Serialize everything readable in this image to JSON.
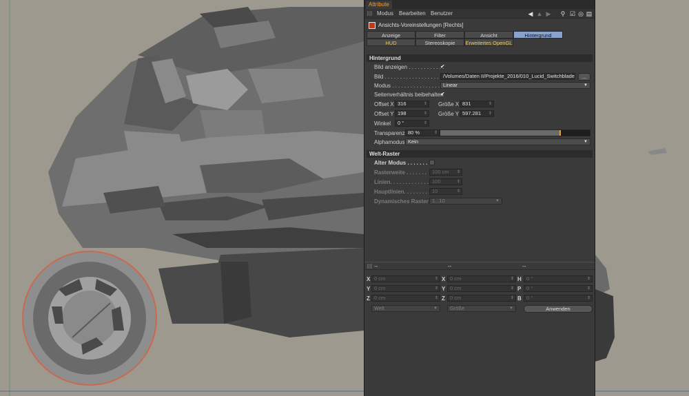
{
  "window": {
    "tab_label": "Attribute"
  },
  "menubar": {
    "items": [
      "Modus",
      "Bearbeiten",
      "Benutzer"
    ],
    "icons": [
      "arrow-left-icon",
      "arrow-up-icon",
      "arrow-right-icon",
      "search-icon",
      "lock-icon",
      "target-icon",
      "new-panel-icon"
    ]
  },
  "object": {
    "title": "Ansichts-Voreinstellungen [Rechts]"
  },
  "tabs": {
    "row1": [
      "Anzeige",
      "Filter",
      "Ansicht",
      "Hintergrund"
    ],
    "row2": [
      "HUD",
      "Stereoskopie",
      "Erweitertes OpenGL"
    ],
    "active": "Hintergrund"
  },
  "hintergrund": {
    "section_title": "Hintergrund",
    "bild_anzeigen_label": "Bild anzeigen . . . . . . . . . . . .",
    "bild_anzeigen_check": "✔",
    "bild_label": "Bild . . . . . . . . . . . . . . . . . . . . .",
    "bild_value": "/Volumes/Daten II/Projekte_2016/010_Lucid_Switchblade_",
    "bild_button": "...",
    "modus_label": "Modus . . . . . . . . . . . . . . . . . .",
    "modus_value": "Linear",
    "seitenverhaeltnis_label": "Seitenverhältnis beibehalten",
    "seitenverhaeltnis_check": "✔",
    "offset_x_label": "Offset X",
    "offset_x_value": "316",
    "groesse_x_label": "Größe X",
    "groesse_x_value": "831",
    "offset_y_label": "Offset Y",
    "offset_y_value": "198",
    "groesse_y_label": "Größe Y",
    "groesse_y_value": "597.281",
    "winkel_label": "Winkel",
    "winkel_value": "0 °",
    "transparenz_label": "Transparenz",
    "transparenz_value": "80 %",
    "transparenz_slider": 0.8,
    "alphamodus_label": "Alphamodus",
    "alphamodus_value": "Kein"
  },
  "welt_raster": {
    "section_title": "Welt-Raster",
    "alter_modus_label": "Alter Modus . . . . . . .",
    "rasterweite_label": "Rasterweite . . . . . . .",
    "rasterweite_value": "100 cm",
    "linien_label": "Linien. . . . . . . . . . . . . . .",
    "linien_value": "100",
    "hauptlinien_label": "Hauptlinien. . . . . . . . . . .",
    "hauptlinien_value": "10",
    "dynamisches_label": "Dynamisches Raster",
    "dynamisches_value": "1...10"
  },
  "coords": {
    "headers": [
      "--",
      "--",
      "--"
    ],
    "rows": [
      {
        "a_label": "X",
        "a_value": "0 cm",
        "b_label": "X",
        "b_value": "0 cm",
        "c_label": "H",
        "c_value": "0 °"
      },
      {
        "a_label": "Y",
        "a_value": "0 cm",
        "b_label": "Y",
        "b_value": "0 cm",
        "c_label": "P",
        "c_value": "0 °"
      },
      {
        "a_label": "Z",
        "a_value": "0 cm",
        "b_label": "Z",
        "b_value": "0 cm",
        "c_label": "B",
        "c_value": "0 °"
      }
    ],
    "dropdown_world": "Welt",
    "dropdown_size": "Größe",
    "apply_button": "Anwenden"
  }
}
